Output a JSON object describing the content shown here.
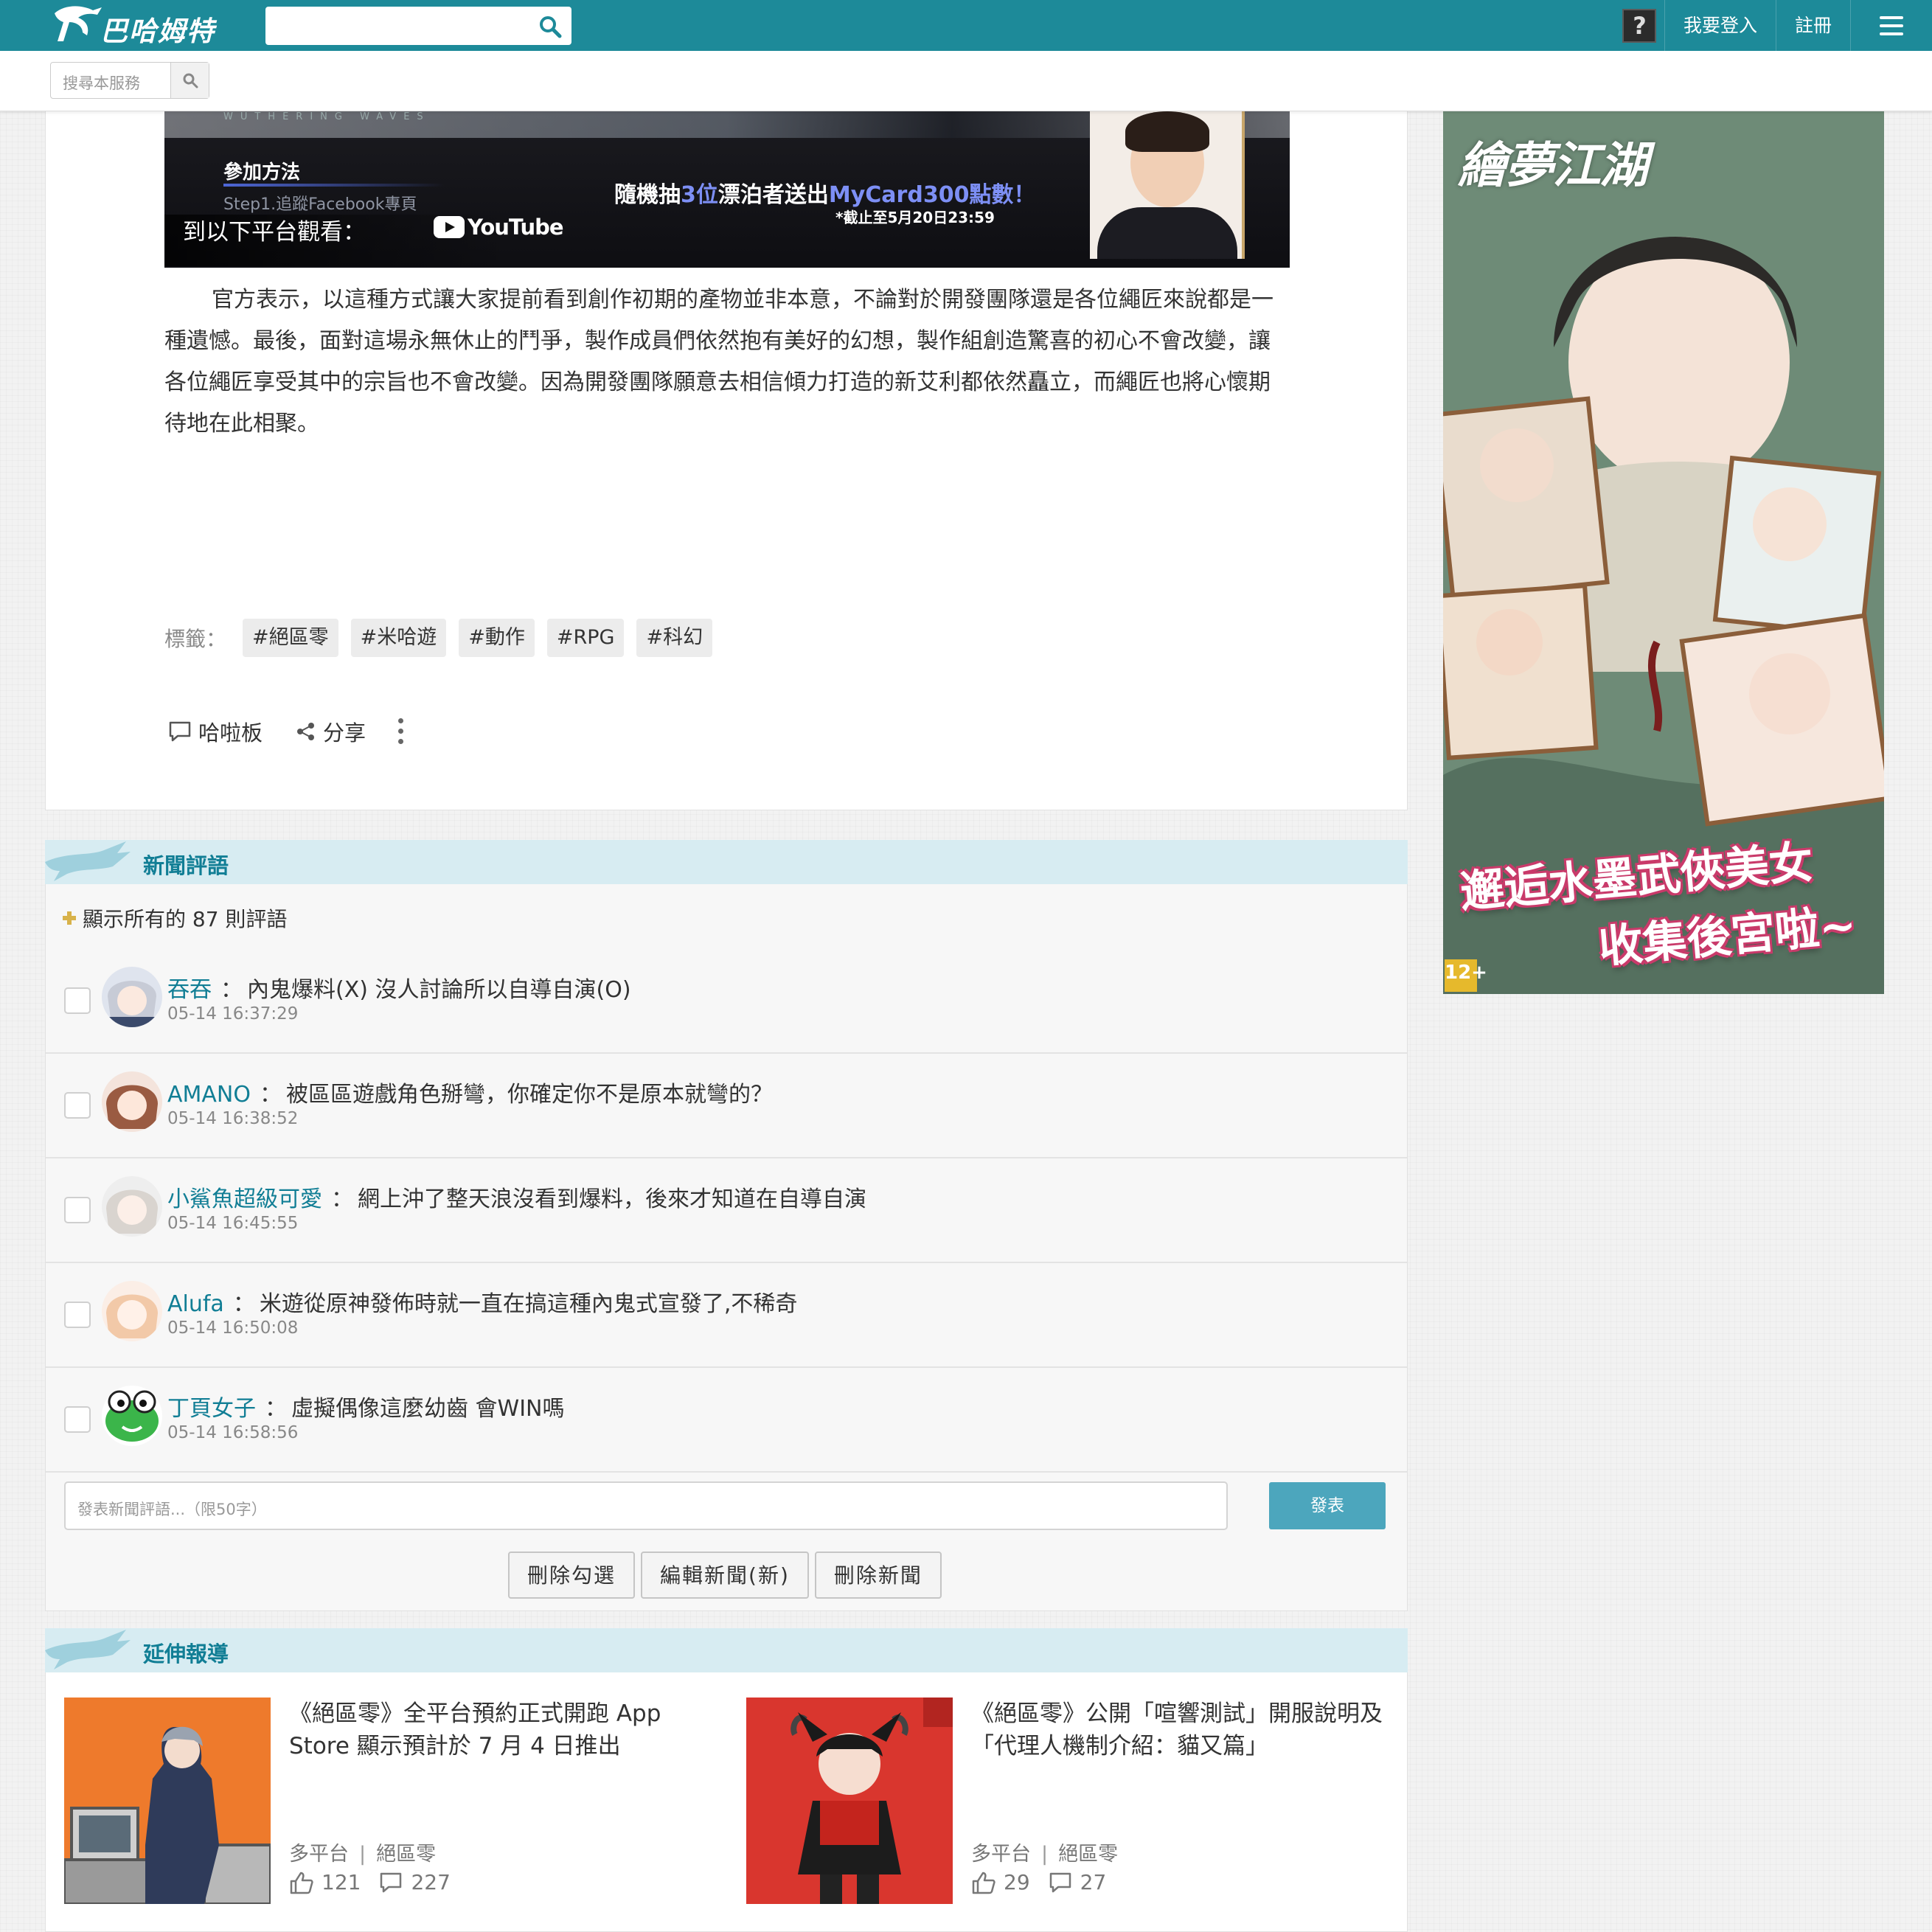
{
  "header": {
    "logo_text": "巴哈姆特",
    "search_value": "",
    "login_label": "我要登入",
    "register_label": "註冊"
  },
  "subbar": {
    "search_placeholder": "搜尋本服務"
  },
  "article": {
    "banner": {
      "top_text": "WUTHERING WAVES",
      "join_title": "參加方法",
      "step_text": "Step1.追蹤Facebook專頁",
      "lottery_pre": "隨機抽",
      "lottery_num": "3位",
      "lottery_mid": "漂泊者送出",
      "lottery_prize": "MyCard300點數！",
      "deadline": "*截止至5月20日23:59",
      "watch_on": "到以下平台觀看：",
      "youtube_label": "YouTube"
    },
    "body": "官方表示，以這種方式讓大家提前看到創作初期的產物並非本意，不論對於開發團隊還是各位繩匠來說都是一種遺憾。最後，面對這場永無休止的鬥爭，製作成員們依然抱有美好的幻想，製作組創造驚喜的初心不會改變，讓各位繩匠享受其中的宗旨也不會改變。因為開發團隊願意去相信傾力打造的新艾利都依然矗立，而繩匠也將心懷期待地在此相聚。",
    "tags_label": "標籤：",
    "tags": [
      "#絕區零",
      "#米哈遊",
      "#動作",
      "#RPG",
      "#科幻"
    ],
    "actions": {
      "forum_label": "哈啦板",
      "share_label": "分享"
    }
  },
  "comments_section": {
    "title": "新聞評語",
    "show_all": "顯示所有的 87 則評語",
    "items": [
      {
        "user": "吞吞",
        "text": "內鬼爆料(X) 沒人討論所以自導自演(O)",
        "time": "05-14 16:37:29"
      },
      {
        "user": "AMANO",
        "text": "被區區遊戲角色掰彎，你確定你不是原本就彎的？",
        "time": "05-14 16:38:52"
      },
      {
        "user": "小鯊魚超級可愛",
        "text": "網上沖了整天浪沒看到爆料，後來才知道在自導自演",
        "time": "05-14 16:45:55"
      },
      {
        "user": "Alufa",
        "text": "米遊從原神發佈時就一直在搞這種內鬼式宣發了,不稀奇",
        "time": "05-14 16:50:08"
      },
      {
        "user": "丁頁女子",
        "text": "虛擬偶像這麼幼齒 會WIN嗎",
        "time": "05-14 16:58:56"
      }
    ],
    "separator": "：",
    "input_placeholder": "發表新聞評語...（限50字）",
    "post_label": "發表",
    "admin_buttons": [
      "刪除勾選",
      "編輯新聞(新)",
      "刪除新聞"
    ]
  },
  "related_section": {
    "title": "延伸報導",
    "items": [
      {
        "title": "《絕區零》全平台預約正式開跑 App Store 顯示預計於 7 月 4 日推出",
        "platform": "多平台",
        "game": "絕區零",
        "likes": "121",
        "comments": "227"
      },
      {
        "title": "《絕區零》公開「喧響測試」開服說明及「代理人機制介紹：貓又篇」",
        "platform": "多平台",
        "game": "絕區零",
        "likes": "29",
        "comments": "27"
      }
    ],
    "meta_bar": "|"
  },
  "ad": {
    "title": "繪夢江湖",
    "slogan_line1": "邂逅水墨武俠美女",
    "slogan_line2": "收集後宮啦~",
    "rating": "12+"
  },
  "colors": {
    "brand": "#1d8a99",
    "link": "#117e95",
    "post_button": "#4ca6bd",
    "section_header": "#d7ecf2"
  }
}
